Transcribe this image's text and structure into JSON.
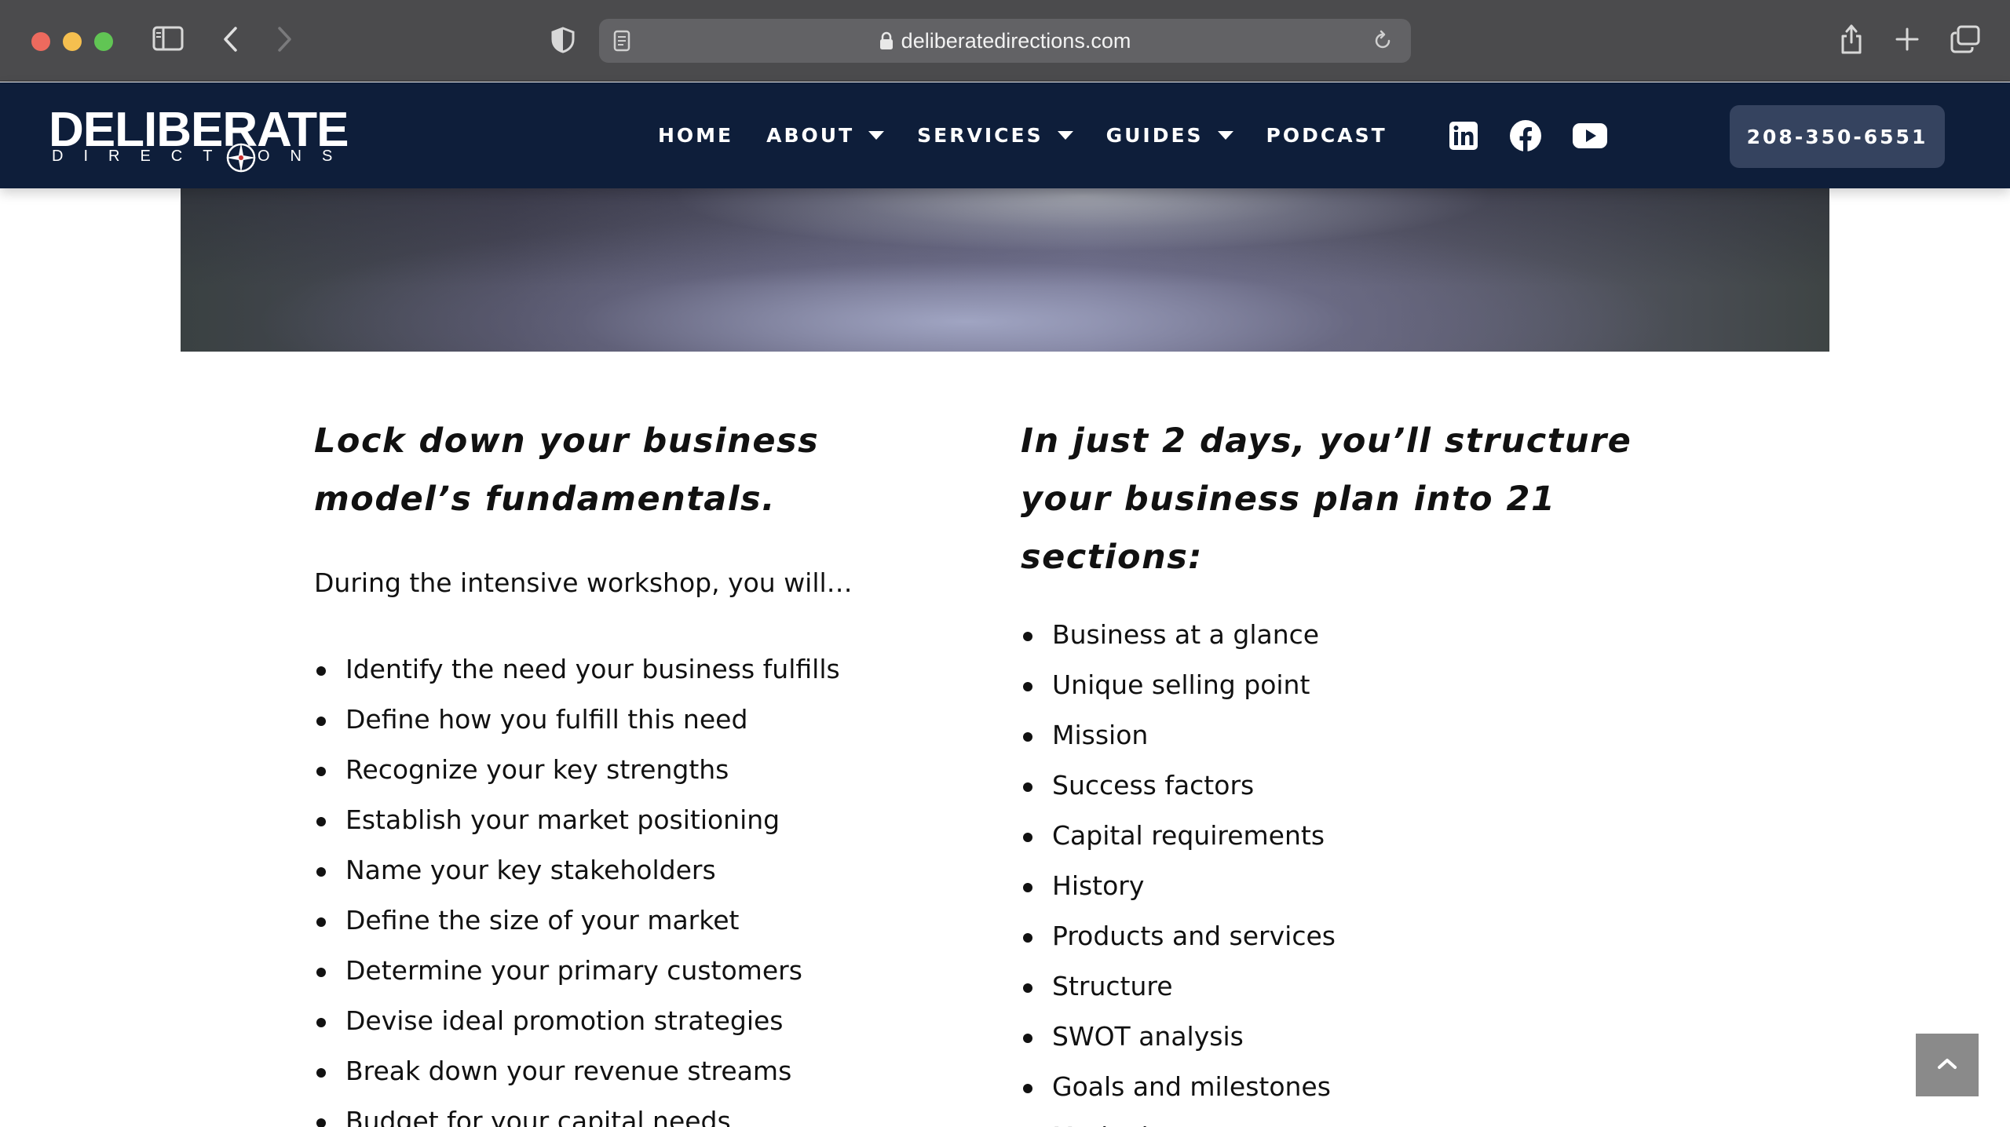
{
  "browser": {
    "url": "deliberatedirections.com"
  },
  "header": {
    "logo_main": "DELIBERATE",
    "logo_sub": "DIRECTIONS",
    "nav": [
      {
        "label": "HOME",
        "has_dropdown": false
      },
      {
        "label": "ABOUT",
        "has_dropdown": true
      },
      {
        "label": "SERVICES",
        "has_dropdown": true
      },
      {
        "label": "GUIDES",
        "has_dropdown": true
      },
      {
        "label": "PODCAST",
        "has_dropdown": false
      }
    ],
    "social": [
      "linkedin-icon",
      "facebook-icon",
      "youtube-icon"
    ],
    "phone": "208-350-6551"
  },
  "left_column": {
    "heading": "Lock down your business model’s fundamentals.",
    "intro": "During the intensive workshop, you will…",
    "items": [
      "Identify the need your business fulfills",
      "Define how you fulfill this need",
      "Recognize your key strengths",
      "Establish your market positioning",
      "Name your key stakeholders",
      "Define the size of your market",
      "Determine your primary customers",
      "Devise ideal promotion strategies",
      "Break down your revenue streams",
      "Budget for your capital needs"
    ]
  },
  "right_column": {
    "heading": "In just 2 days, you’ll structure your business plan into 21 sections:",
    "items": [
      "Business at a glance",
      "Unique selling point",
      "Mission",
      "Success factors",
      "Capital requirements",
      "History",
      "Products and services",
      "Structure",
      "SWOT analysis",
      "Goals and milestones",
      "Marketing"
    ]
  },
  "colors": {
    "header_bg": "#0e1e3a",
    "phone_button_bg": "#35435f",
    "chrome_bg": "#4b4b4d"
  }
}
